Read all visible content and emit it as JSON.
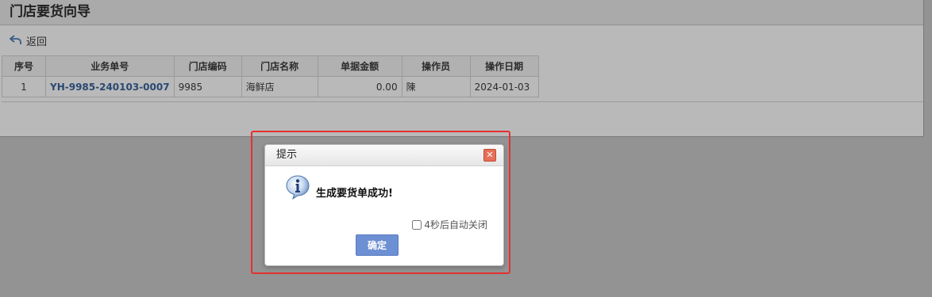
{
  "page": {
    "title": "门店要货向导",
    "back_label": "返回"
  },
  "table": {
    "columns": [
      "序号",
      "业务单号",
      "门店编码",
      "门店名称",
      "单据金额",
      "操作员",
      "操作日期"
    ],
    "rows": [
      {
        "seq": "1",
        "order_no": "YH-9985-240103-0007",
        "store_code": "9985",
        "store_name": "海鲜店",
        "amount": "0.00",
        "operator": "陳",
        "date": "2024-01-03"
      }
    ]
  },
  "dialog": {
    "title": "提示",
    "message": "生成要货单成功!",
    "auto_close_label": "4秒后自动关闭",
    "auto_close_checked": false,
    "ok_label": "确定",
    "close_icon": "close-icon",
    "message_icon": "info-icon"
  },
  "colors": {
    "highlight": "#e53030",
    "ok_button": "#6d8fd3",
    "link": "#1f4f8f"
  }
}
